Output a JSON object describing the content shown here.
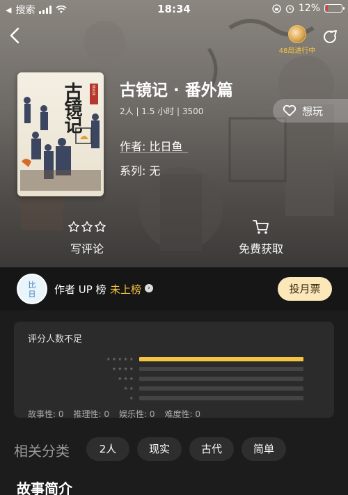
{
  "status_bar": {
    "back_app": "搜索",
    "time": "18:34",
    "battery": "12%",
    "battery_level": 0.12
  },
  "nav": {
    "game_badge": "48局进行中"
  },
  "book": {
    "title": "古镜记 · 番外篇",
    "meta": "2人 | 1.5 小时 | 3500",
    "author_label": "作者:",
    "author": "比日鱼",
    "series_label": "系列:",
    "series": "无",
    "cover_title": "古镜记",
    "cover_seal": "番外篇"
  },
  "want_button": {
    "label": "想玩",
    "icon": "heart-icon"
  },
  "actions": {
    "review": {
      "label": "写评论",
      "icon": "stars-outline-icon"
    },
    "free": {
      "label": "免费获取",
      "icon": "cart-icon"
    }
  },
  "rank": {
    "label": "作者 UP 榜",
    "status": "未上榜",
    "vote_button": "投月票"
  },
  "rating": {
    "label": "评分人数不足",
    "distribution": [
      {
        "stars": "★★★★★",
        "fraction": 1.0
      },
      {
        "stars": "★★★★",
        "fraction": 0
      },
      {
        "stars": "★★★",
        "fraction": 0
      },
      {
        "stars": "★★",
        "fraction": 0
      },
      {
        "stars": "★",
        "fraction": 0
      }
    ],
    "scores": {
      "story": "故事性: 0",
      "logic": "推理性: 0",
      "fun": "娱乐性: 0",
      "difficulty": "难度性: 0"
    }
  },
  "categories": {
    "title": "相关分类",
    "tags": [
      "2人",
      "现实",
      "古代",
      "简单"
    ]
  },
  "intro": {
    "title": "故事简介"
  },
  "colors": {
    "accent": "#f5c542",
    "vote_bg": "#fbe7b8"
  }
}
